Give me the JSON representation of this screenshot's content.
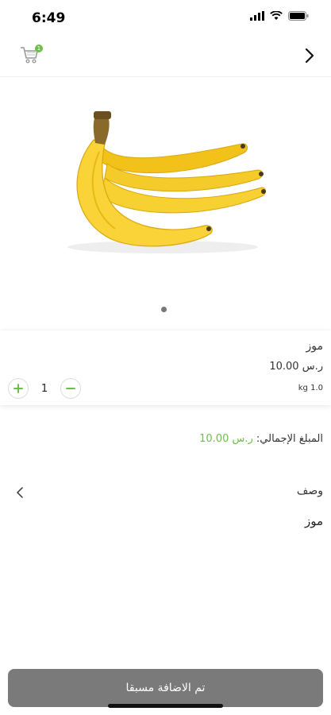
{
  "status": {
    "time": "6:49"
  },
  "nav": {
    "cart_badge": "1"
  },
  "product": {
    "name": "موز",
    "price": "ر.س 10.00",
    "weight": "kg 1.0",
    "quantity": "1"
  },
  "total": {
    "label": "المبلغ الإجمالي:",
    "amount": "ر.س 10.00"
  },
  "description": {
    "title": "وصف",
    "body": "موز"
  },
  "cta": {
    "label": "تم الاضافة مسبقا"
  },
  "colors": {
    "accent": "#6cc04a",
    "button": "#7a7a7a"
  }
}
